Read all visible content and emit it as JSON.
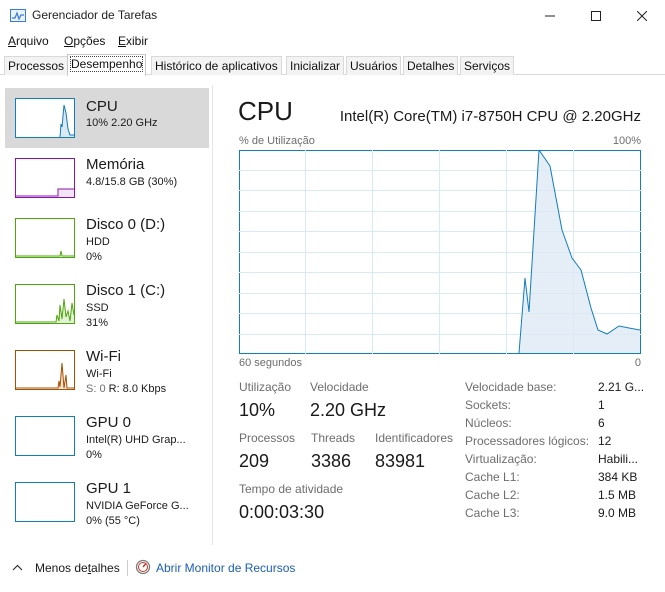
{
  "window": {
    "title": "Gerenciador de Tarefas",
    "minimize_glyph": "—",
    "maximize_glyph": "☐",
    "close_glyph": "✕"
  },
  "menu": {
    "items": [
      {
        "underline": "A",
        "rest": "rquivo"
      },
      {
        "underline": "O",
        "rest": "pções"
      },
      {
        "underline": "E",
        "rest": "xibir"
      }
    ]
  },
  "tabs": [
    {
      "label": "Processos"
    },
    {
      "label": "Desempenho",
      "active": true
    },
    {
      "label": "Histórico de aplicativos"
    },
    {
      "label": "Inicializar"
    },
    {
      "label": "Usuários"
    },
    {
      "label": "Detalhes"
    },
    {
      "label": "Serviços"
    }
  ],
  "sidebar": {
    "items": [
      {
        "title": "CPU",
        "sub1": "10% 2.20 GHz",
        "sub2": "",
        "color": "#117dbb",
        "selected": true
      },
      {
        "title": "Memória",
        "sub1": "4.8/15.8 GB (30%)",
        "sub2": "",
        "color": "#8b12ae"
      },
      {
        "title": "Disco 0 (D:)",
        "sub1": "HDD",
        "sub2": "0%",
        "color": "#4da60c"
      },
      {
        "title": "Disco 1 (C:)",
        "sub1": "SSD",
        "sub2": "31%",
        "color": "#4da60c"
      },
      {
        "title": "Wi-Fi",
        "sub1": "Wi-Fi",
        "sub2_prefix": "S: 0 ",
        "sub2_suffix": "R: 8.0 Kbps",
        "color": "#a74f01"
      },
      {
        "title": "GPU 0",
        "sub1": "Intel(R) UHD Grap...",
        "sub2": "0%",
        "color": "#117dbb"
      },
      {
        "title": "GPU 1",
        "sub1": "NVIDIA GeForce G...",
        "sub2": "0% (55 °C)",
        "color": "#117dbb"
      }
    ]
  },
  "main": {
    "title": "CPU",
    "subtitle": "Intel(R) Core(TM) i7-8750H CPU @ 2.20GHz",
    "graph": {
      "top_left_label": "% de Utilização",
      "top_right_label": "100%",
      "bottom_left_label": "60 segundos",
      "bottom_right_label": "0",
      "color": "#117dbb"
    },
    "stats": {
      "utilization_label": "Utilização",
      "utilization_value": "10%",
      "speed_label": "Velocidade",
      "speed_value": "2.20 GHz",
      "processes_label": "Processos",
      "processes_value": "209",
      "threads_label": "Threads",
      "threads_value": "3386",
      "handles_label": "Identificadores",
      "handles_value": "83981",
      "uptime_label": "Tempo de atividade",
      "uptime_value": "0:00:03:30"
    },
    "details": [
      {
        "label": "Velocidade base:",
        "value": "2.21 G..."
      },
      {
        "label": "Sockets:",
        "value": "1"
      },
      {
        "label": "Núcleos:",
        "value": "6"
      },
      {
        "label": "Processadores lógicos:",
        "value": "12"
      },
      {
        "label": "Virtualização:",
        "value": "Habili..."
      },
      {
        "label": "Cache L1:",
        "value": "384 KB"
      },
      {
        "label": "Cache L2:",
        "value": "1.5 MB"
      },
      {
        "label": "Cache L3:",
        "value": "9.0 MB"
      }
    ]
  },
  "footer": {
    "less_details": "Menos detalhes",
    "less_details_underline": "t",
    "open_monitor": "Abrir Monitor de Recursos"
  }
}
